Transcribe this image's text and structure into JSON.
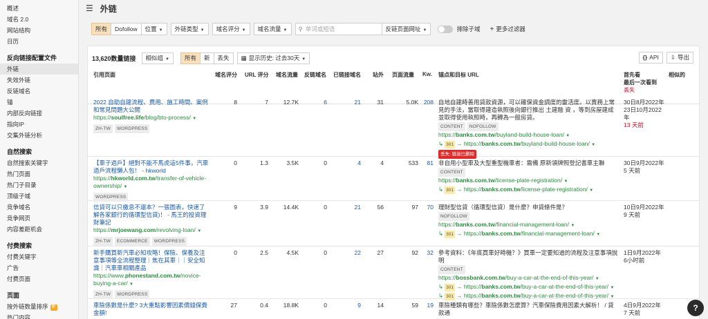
{
  "sidebar": {
    "items_top": [
      "概述",
      "域名 2.0",
      "网站结构",
      "日历"
    ],
    "section_backlinks": "反向链接配置文件",
    "backlinks_items": [
      "外链",
      "失效外链",
      "反链域名",
      "锚",
      "内部反向链接",
      "指向IP",
      "交集外链分析"
    ],
    "section_organic": "自然搜索",
    "organic_items": [
      "自然搜索关键字",
      "热门页面",
      "热门子目录",
      "顶级子域",
      "竞争域名",
      "竞争网页",
      "内容差距机会"
    ],
    "section_paid": "付费搜索",
    "paid_items": [
      "付费关键字",
      "广告",
      "付费页面"
    ],
    "section_pages": "页面",
    "pages_items": [
      "按外链数量排序",
      "热门内容"
    ],
    "new_badge": "新"
  },
  "header": {
    "title": "外链"
  },
  "filters": {
    "all": "所有",
    "dofollow": "Dofollow",
    "position": "位置",
    "link_type": "外链类型",
    "dr": "域名评分",
    "domain_traffic": "域名流量",
    "search_placeholder": "单词或短语",
    "url_select": "反链页面网址",
    "exclude_subdomains": "排除子域",
    "more_filters": "更多过滤器"
  },
  "panel": {
    "count": "13,620数量链接",
    "group": "相似组",
    "tab_all": "所有",
    "tab_new": "新",
    "tab_lost": "丢失",
    "history": "显示历史: 过去30天",
    "api": "API",
    "export": "导出"
  },
  "columns": {
    "ref_page": "引用页面",
    "dr": "域名评分",
    "ur": "URL 评分",
    "domain_traffic": "域名流量",
    "ref_domains": "反链域名",
    "linked_domains": "已链接域名",
    "ext": "站外",
    "page_traffic": "页面流量",
    "kw": "Kw.",
    "anchor": "锚点和目标 URL",
    "first_seen": "首先看",
    "last_seen": "最后一次看到",
    "lost": "丢失",
    "similar": "相似的"
  },
  "rows": [
    {
      "title": "2022 自助自建流程、费用、施工時間、案例和常見問題大公開",
      "url_prefix": "https://",
      "url_domain": "soulfree.life",
      "url_path": "/blog/bto-process/",
      "tags": [
        "ZH-TW",
        "WORDPRESS"
      ],
      "dr": "8",
      "ur": "7",
      "traffic": "12.7K",
      "ref": "6",
      "linked": "21",
      "ext": "31",
      "page_traffic": "5.0K",
      "kw": "208",
      "anchor": "自地自建時善用貸款資源，可以確保資金調度的靈活度。以賣務上常見的手法，當取得建造執照後向銀行推出 土建融 資 ，等到房屋建成並取得使用執照時，再轉為一般房貸。",
      "anchor_tags": [
        "CONTENT",
        "NOFOLLOW"
      ],
      "target_prefix": "https://",
      "target_domain": "banks.com.tw",
      "target_path": "/buyland-build-house-loan/",
      "redirect_code": "301",
      "lost_badge": "丢失: 链接已删除",
      "first_seen": "30日8月2022年",
      "last_seen": "23日10月2022年",
      "ago": "13 天前",
      "ago_red": true
    },
    {
      "title": "【車子過戶】絕對不能不馬虎這5件事，汽車過戶流程懶人包！ - hkworld",
      "url_prefix": "https://",
      "url_domain": "hkworld.com.tw",
      "url_path": "/transfer-of-vehicle-ownership/",
      "tags": [
        "WORDPRESS"
      ],
      "dr": "0",
      "ur": "1.3",
      "traffic": "3.5K",
      "ref": "0",
      "linked": "4",
      "ext": "4",
      "page_traffic": "533",
      "kw": "81",
      "anchor": "非自用小型車及大型重型機車者：需備 原新領牌照登記書車主聯",
      "anchor_tags": [
        "CONTENT"
      ],
      "target_prefix": "https://",
      "target_domain": "banks.com.tw",
      "target_path": "/license-plate-registration/",
      "redirect_code": "301",
      "lost_badge": "",
      "first_seen": "30日9月2022年",
      "last_seen": "",
      "ago": "5 天前",
      "ago_red": false
    },
    {
      "title": "信貸可以只繳息不還本？一張圖表，快速了解各家銀行的循環型信貸)！ - 馬王的投資理財筆記",
      "url_prefix": "https://",
      "url_domain": "mrjoewang.com",
      "url_path": "/revolving-loan/",
      "tags": [
        "ZH-TW",
        "ECOMMERCE",
        "WORDPRESS"
      ],
      "dr": "9",
      "ur": "3.9",
      "traffic": "14.4K",
      "ref": "0",
      "linked": "21",
      "ext": "56",
      "page_traffic": "97",
      "kw": "70",
      "anchor": "理財型信貸（循環型信貸）是什麼？申貸條件是？",
      "anchor_tags": [
        "NOFOLLOW"
      ],
      "target_prefix": "https://",
      "target_domain": "banks.com.tw",
      "target_path": "/financial-management-loan/",
      "redirect_code": "301",
      "lost_badge": "",
      "first_seen": "10日9月2022年",
      "last_seen": "",
      "ago": "9 天前",
      "ago_red": false
    },
    {
      "title": "新手購買新汽車必知攻略！保險、保養及注意事項等全流程整理｜焦在其車｜｜安全知識｜汽車車相關產品",
      "url_prefix": "https://www.",
      "url_domain": "phonestand.com.tw",
      "url_path": "/novice-buying-a-car/",
      "tags": [
        "ZH-TW",
        "WORDPRESS"
      ],
      "dr": "0",
      "ur": "2.5",
      "traffic": "4.5K",
      "ref": "0",
      "linked": "22",
      "ext": "27",
      "page_traffic": "92",
      "kw": "32",
      "anchor": "參考資料：《年底買車好時機？》買車一定要知道的流程及注意事項說明",
      "anchor_tags": [
        "CONTENT"
      ],
      "target_prefix": "https://",
      "target_domain": "bossbank.com.tw",
      "target_path": "/buy-a-car-at-the-end-of-this-year/",
      "target2_domain": "banks.com.tw",
      "target2_path": "/buy-a-car-at-the-end-of-this-year/",
      "redirect_code": "301",
      "lost_badge": "",
      "first_seen": "1日9月2022年",
      "last_seen": "",
      "ago": "6小时前",
      "ago_red": false
    },
    {
      "title": "車險係數是什麼? 3大重點影響因素價錢保費金額!",
      "dr": "27",
      "ur": "0.4",
      "traffic": "18.8K",
      "ref": "0",
      "linked": "9",
      "ext": "14",
      "page_traffic": "59",
      "kw": "19",
      "anchor": "車險種類有哪些？車險係數怎麼算？汽車保險費用因素大解析！ / 貸款通",
      "first_seen": "4日9月2022年",
      "ago": "7 天前"
    }
  ],
  "colors": {
    "accent_orange": "#f8e0bd",
    "link_blue": "#1a5aa6",
    "url_green": "#2a8a3e",
    "lost_red": "#d0021b"
  },
  "icons": [
    "menu-icon",
    "search-icon",
    "plus-icon",
    "calendar-icon",
    "api-icon",
    "export-icon",
    "help-icon"
  ]
}
